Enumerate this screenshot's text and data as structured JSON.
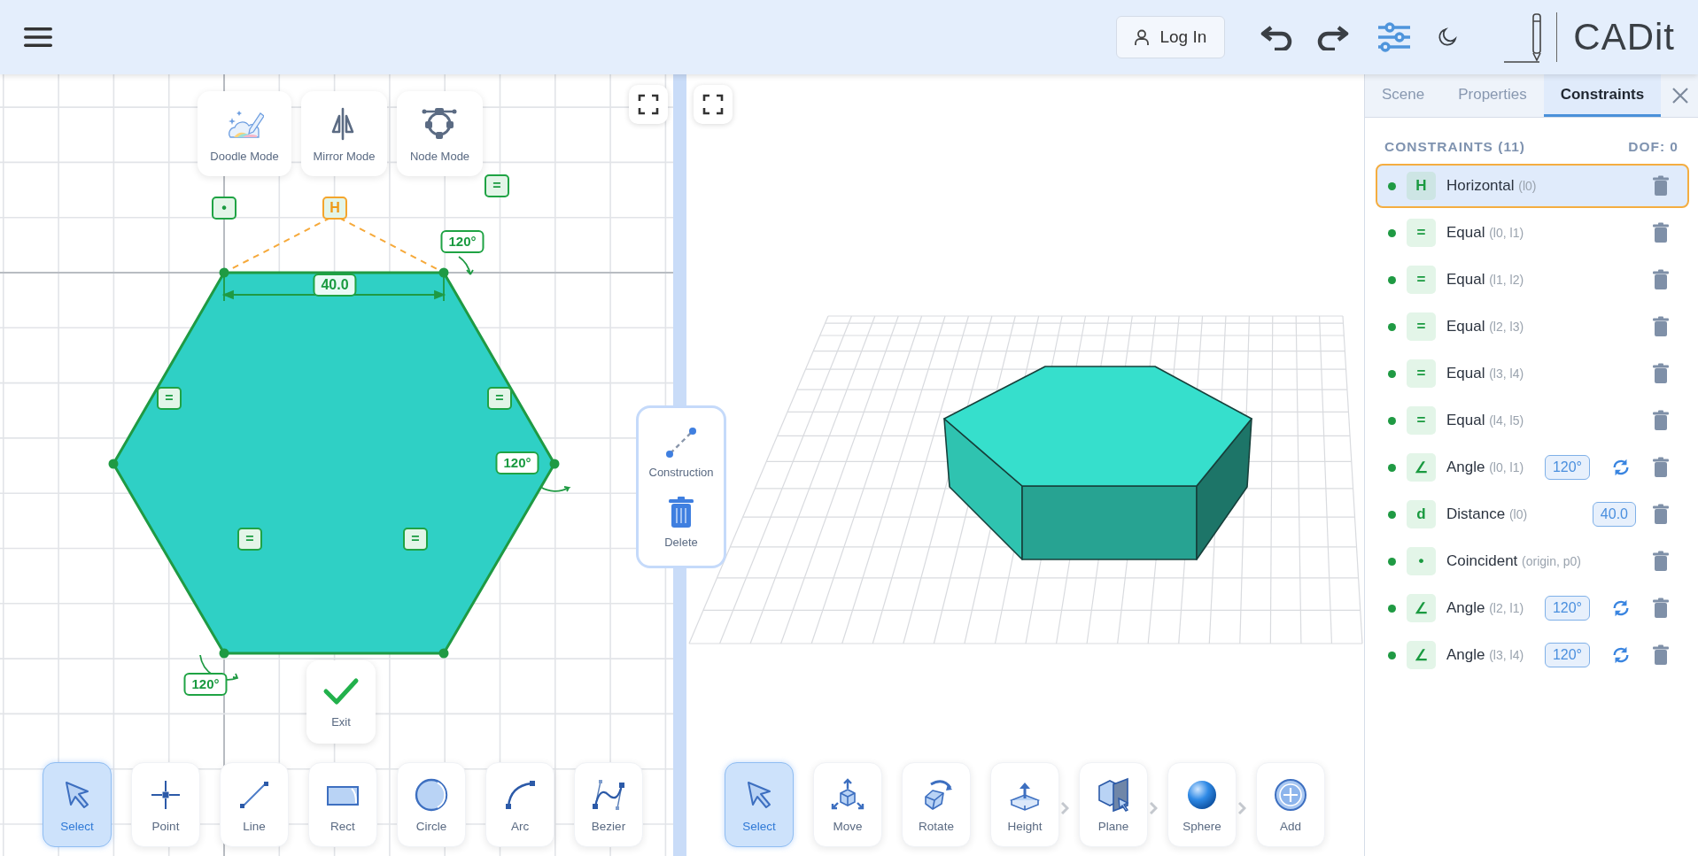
{
  "header": {
    "login": "Log In",
    "brand": "CADit"
  },
  "sketch": {
    "modes": [
      {
        "label": "Doodle Mode"
      },
      {
        "label": "Mirror Mode"
      },
      {
        "label": "Node Mode"
      }
    ],
    "annotations": [
      {
        "kind": "coincident",
        "text": "•"
      },
      {
        "kind": "horizontal",
        "text": "H"
      },
      {
        "kind": "equal",
        "text": "="
      },
      {
        "kind": "angle",
        "text": "120°"
      },
      {
        "kind": "distance",
        "text": "40.0"
      },
      {
        "kind": "equal",
        "text": "="
      },
      {
        "kind": "equal",
        "text": "="
      },
      {
        "kind": "angle",
        "text": "120°"
      },
      {
        "kind": "equal",
        "text": "="
      },
      {
        "kind": "equal",
        "text": "="
      },
      {
        "kind": "angle",
        "text": "120°"
      }
    ],
    "exit": "Exit",
    "tools": [
      {
        "label": "Select",
        "selected": true
      },
      {
        "label": "Point",
        "selected": false
      },
      {
        "label": "Line",
        "selected": false
      },
      {
        "label": "Rect",
        "selected": false
      },
      {
        "label": "Circle",
        "selected": false
      },
      {
        "label": "Arc",
        "selected": false
      },
      {
        "label": "Bezier",
        "selected": false
      }
    ]
  },
  "context_menu": {
    "items": [
      {
        "label": "Construction"
      },
      {
        "label": "Delete"
      }
    ]
  },
  "viewport": {
    "tools": [
      {
        "label": "Select",
        "selected": true,
        "has_menu": false
      },
      {
        "label": "Move",
        "selected": false,
        "has_menu": false
      },
      {
        "label": "Rotate",
        "selected": false,
        "has_menu": false
      },
      {
        "label": "Height",
        "selected": false,
        "has_menu": true
      },
      {
        "label": "Plane",
        "selected": false,
        "has_menu": true
      },
      {
        "label": "Sphere",
        "selected": false,
        "has_menu": true
      },
      {
        "label": "Add",
        "selected": false,
        "has_menu": false
      }
    ]
  },
  "panel": {
    "tabs": [
      {
        "label": "Scene",
        "selected": false
      },
      {
        "label": "Properties",
        "selected": false
      },
      {
        "label": "Constraints",
        "selected": true
      }
    ],
    "title": "CONSTRAINTS (11)",
    "dof": "DOF: 0",
    "constraints": [
      {
        "symbol": "H",
        "name": "Horizontal",
        "args": "(l0)",
        "selected": true
      },
      {
        "symbol": "=",
        "name": "Equal",
        "args": "(l0, l1)",
        "selected": false
      },
      {
        "symbol": "=",
        "name": "Equal",
        "args": "(l1, l2)",
        "selected": false
      },
      {
        "symbol": "=",
        "name": "Equal",
        "args": "(l2, l3)",
        "selected": false
      },
      {
        "symbol": "=",
        "name": "Equal",
        "args": "(l3, l4)",
        "selected": false
      },
      {
        "symbol": "=",
        "name": "Equal",
        "args": "(l4, l5)",
        "selected": false
      },
      {
        "symbol": "∠",
        "name": "Angle",
        "args": "(l0, l1)",
        "value": "120°",
        "swappable": true,
        "selected": false
      },
      {
        "symbol": "d",
        "name": "Distance",
        "args": "(l0)",
        "value": "40.0",
        "swappable": false,
        "selected": false
      },
      {
        "symbol": "•",
        "name": "Coincident",
        "args": "(origin, p0)",
        "selected": false
      },
      {
        "symbol": "∠",
        "name": "Angle",
        "args": "(l2, l1)",
        "value": "120°",
        "swappable": true,
        "selected": false
      },
      {
        "symbol": "∠",
        "name": "Angle",
        "args": "(l3, l4)",
        "value": "120°",
        "swappable": true,
        "selected": false
      }
    ]
  }
}
